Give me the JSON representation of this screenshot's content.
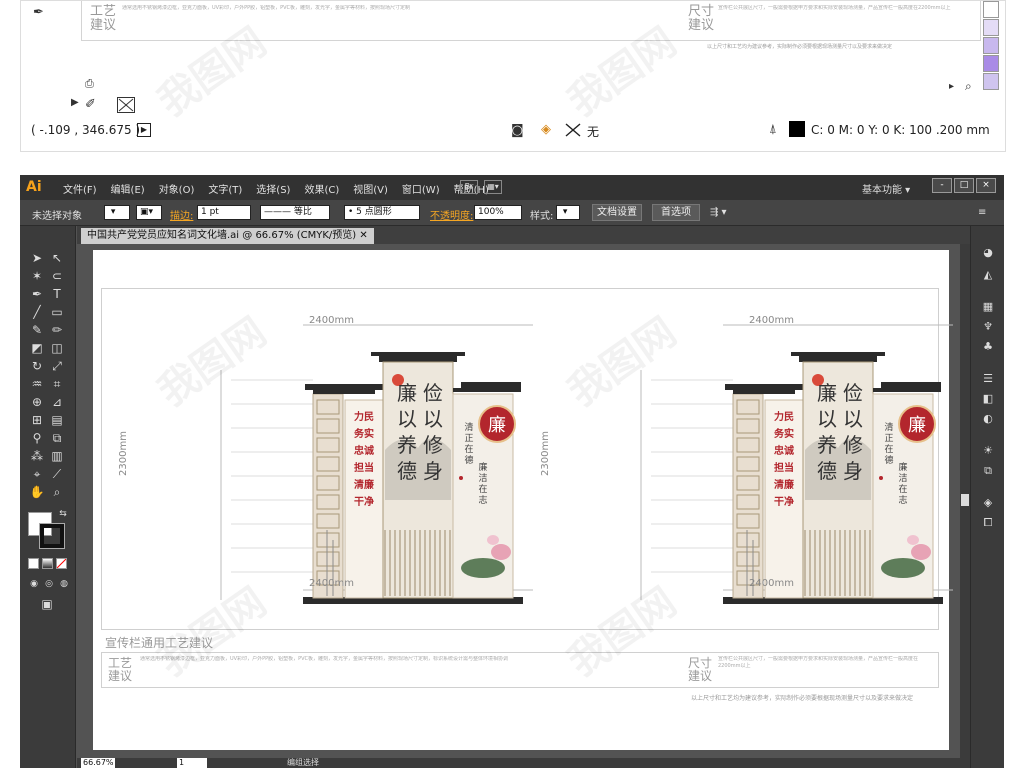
{
  "top_preview": {
    "side_left": "工艺建议",
    "side_right": "尺寸建议",
    "note_right": "以上尺寸和工艺均为建议参考，实际制作必须要根据现场测量尺寸以及要求来做决定",
    "coords": "( -.109 , 346.675 )",
    "fill_none": "无",
    "color_readout": "C: 0 M: 0 Y: 0 K: 100  .200 mm",
    "swatch_colors": [
      "#ffffff",
      "#e4dcf6",
      "#c8b8ee",
      "#a98be6",
      "#cfc4ee"
    ]
  },
  "app": {
    "logo": "Ai",
    "menu": [
      "文件(F)",
      "编辑(E)",
      "对象(O)",
      "文字(T)",
      "选择(S)",
      "效果(C)",
      "视图(V)",
      "窗口(W)",
      "帮助(H)"
    ],
    "menu_icon_br": "Br",
    "workspace": "基本功能",
    "window_buttons": [
      "-",
      "□",
      "×"
    ]
  },
  "control": {
    "selection": "未选择对象",
    "stroke_label": "描边:",
    "stroke_value": "1 pt",
    "uniform": "等比",
    "brush": "5 点圆形",
    "opacity_label": "不透明度:",
    "opacity_value": "100%",
    "style_label": "样式:",
    "doc_setup": "文档设置",
    "prefs": "首选项"
  },
  "document": {
    "tab": "中国共产党党员应知名词文化墙.ai @ 66.67% (CMYK/预览)",
    "zoom": "66.67%",
    "page": "1",
    "status": "编组选择"
  },
  "artboard": {
    "width_label": "2400mm",
    "height_label": "2300mm",
    "section_title": "宣传栏通用工艺建议",
    "craft_label": "工艺建议",
    "size_label": "尺寸建议",
    "bottom_note": "以上尺寸和工艺均为建议参考，实际制作必须要根据现场测量尺寸以及要求来做决定",
    "sign": {
      "calligraphy": [
        "俭以修身",
        "廉以养德"
      ],
      "left_panel": [
        "力民",
        "务实",
        "忠诚",
        "担当",
        "清廉",
        "干净"
      ],
      "seal": "廉",
      "vertical_left": "清正在德",
      "vertical_right": "廉洁在志"
    }
  },
  "watermark": "我图网",
  "colors": {
    "roof": "#2b2b2b",
    "panel": "#e8ded0",
    "red": "#b3262d",
    "menubar": "#323232",
    "accent": "#f7a21b"
  }
}
